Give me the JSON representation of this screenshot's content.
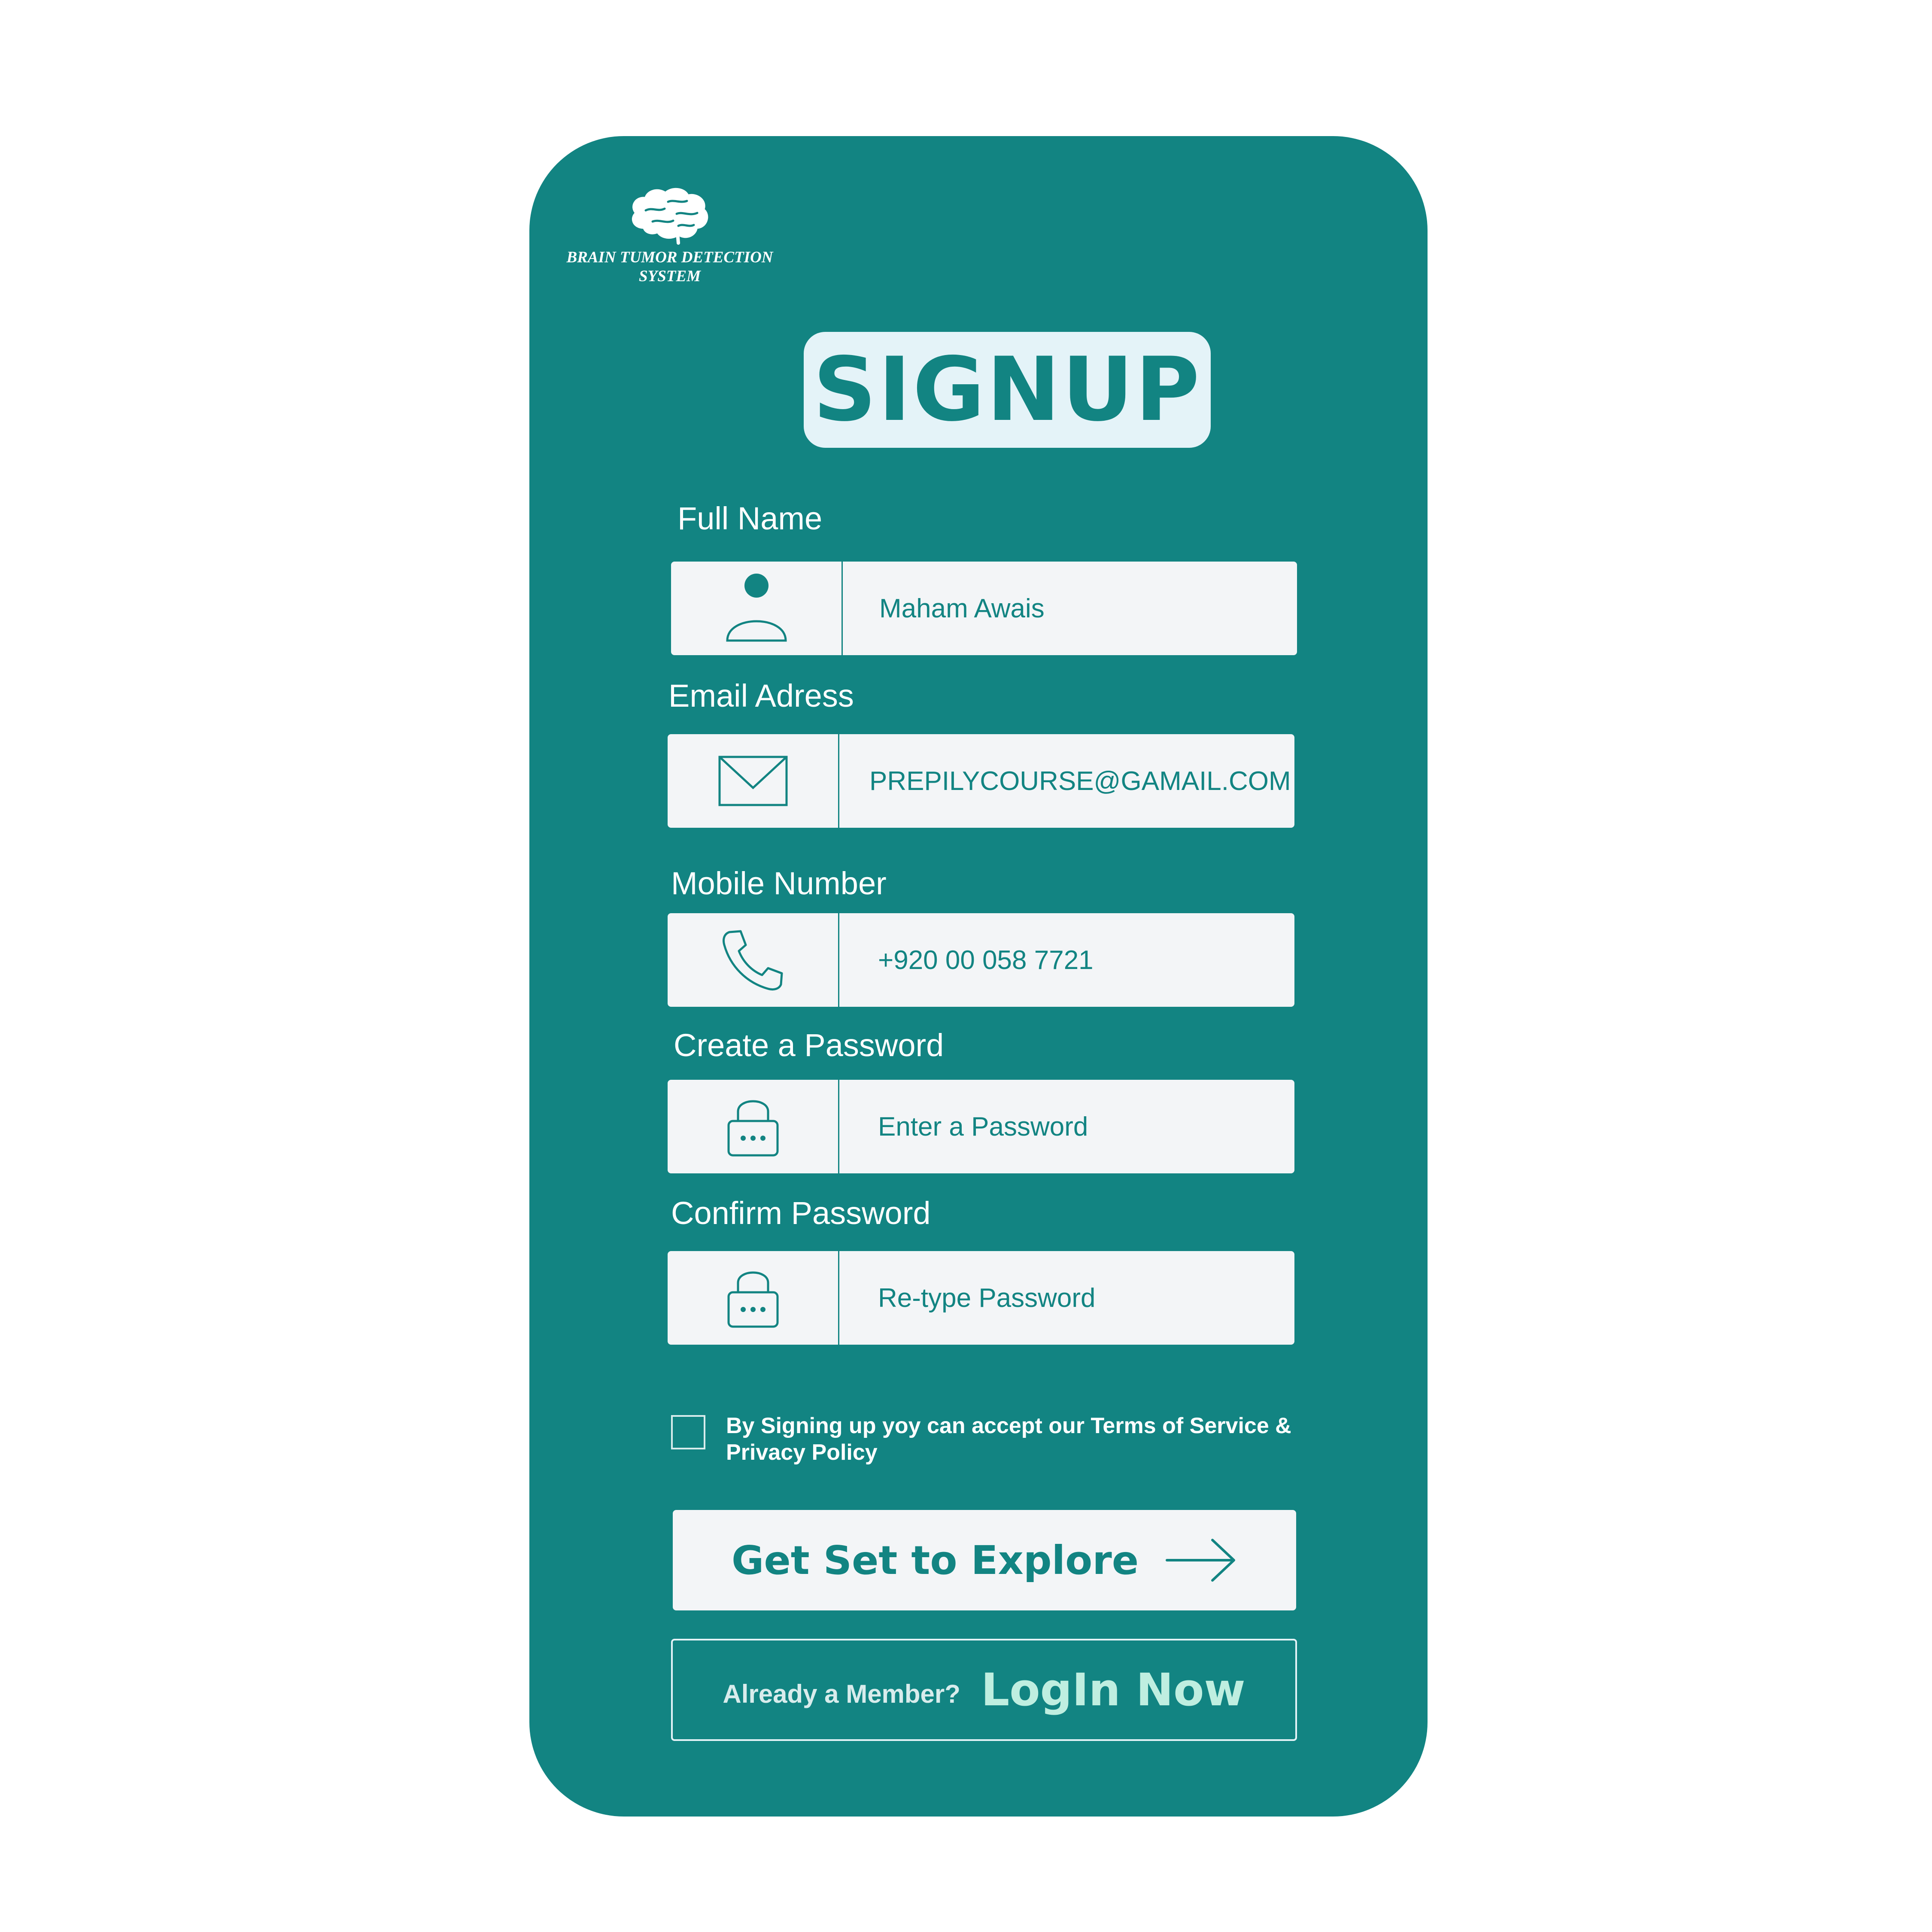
{
  "app": {
    "logo_text": "BRAIN TUMOR DETECTION\nSYSTEM",
    "title": "SIGNUP"
  },
  "colors": {
    "card": "#128482",
    "field_bg": "#f3f5f7",
    "title_bg": "#e4f3f8",
    "link": "#bfeee0"
  },
  "fields": [
    {
      "label": "Full Name",
      "value": "Maham Awais",
      "placeholder": "",
      "icon": "user-icon"
    },
    {
      "label": "Email Adress",
      "value": "PREPILYCOURSE@GAMAIL.COM",
      "placeholder": "",
      "icon": "mail-icon"
    },
    {
      "label": "Mobile Number",
      "value": "+920 00 058 7721",
      "placeholder": "",
      "icon": "phone-icon"
    },
    {
      "label": "Create a Password",
      "value": "",
      "placeholder": "Enter a Password",
      "icon": "lock-icon"
    },
    {
      "label": "Confirm Password",
      "value": "",
      "placeholder": "Re-type Password",
      "icon": "lock-icon"
    }
  ],
  "terms": {
    "text": "By Signing up yoy can accept our Terms of Service & Privacy Policy",
    "checked": false
  },
  "buttons": {
    "explore": "Get Set to Explore",
    "member_question": "Already a Member?",
    "login": "LogIn Now"
  }
}
